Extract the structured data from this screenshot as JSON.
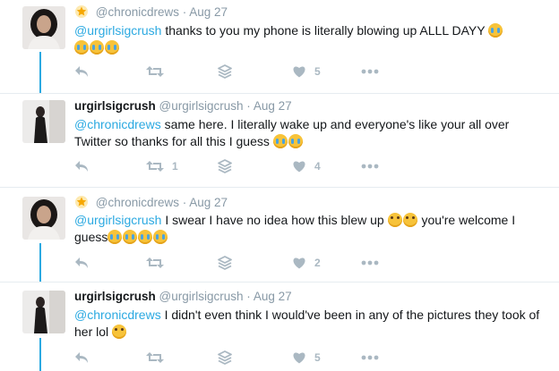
{
  "tweets": [
    {
      "show_star": true,
      "display_name": "",
      "handle": "@chronicdrews",
      "date": "Aug 27",
      "mention": "@urgirlsigcrush",
      "text_before": " thanks to you my phone is literally blowing up ALLL DAYY ",
      "emoji_inline": [
        "loudly-crying-face-emoji"
      ],
      "text_after": "",
      "emoji_line2": [
        "loudly-crying-face-emoji",
        "loudly-crying-face-emoji",
        "loudly-crying-face-emoji"
      ],
      "retweet_count": "",
      "like_count": "5"
    },
    {
      "show_star": false,
      "display_name": "urgirlsigcrush",
      "handle": "@urgirlsigcrush",
      "date": "Aug 27",
      "mention": "@chronicdrews",
      "text_before": " same here. I literally wake up and everyone's like your all over Twitter so thanks for all this I guess ",
      "emoji_inline": [
        "loudly-crying-face-emoji",
        "loudly-crying-face-emoji"
      ],
      "text_after": "",
      "emoji_line2": [],
      "retweet_count": "1",
      "like_count": "4"
    },
    {
      "show_star": true,
      "display_name": "",
      "handle": "@chronicdrews",
      "date": "Aug 27",
      "mention": "@urgirlsigcrush",
      "text_before": " I swear I have no idea how this blew up ",
      "emoji_inline": [
        "face-with-tears-of-joy-emoji",
        "face-with-tears-of-joy-emoji"
      ],
      "text_after": " you're welcome I guess",
      "emoji_line2": [
        "loudly-crying-face-emoji",
        "loudly-crying-face-emoji",
        "loudly-crying-face-emoji",
        "loudly-crying-face-emoji"
      ],
      "retweet_count": "",
      "like_count": "2"
    },
    {
      "show_star": false,
      "display_name": "urgirlsigcrush",
      "handle": "@urgirlsigcrush",
      "date": "Aug 27",
      "mention": "@chronicdrews",
      "text_before": " I didn't even think I would've been in any of the pictures they took of her lol ",
      "emoji_inline": [
        "face-with-tears-of-joy-emoji"
      ],
      "text_after": "",
      "emoji_line2": [],
      "retweet_count": "",
      "like_count": "5"
    }
  ],
  "separator": "·",
  "colors": {
    "accent": "#2ba9e1",
    "muted": "#8899a6",
    "icon": "#aab8c2"
  },
  "icons": [
    "reply-icon",
    "retweet-icon",
    "stack-icon",
    "heart-icon",
    "more-icon",
    "star-icon"
  ]
}
